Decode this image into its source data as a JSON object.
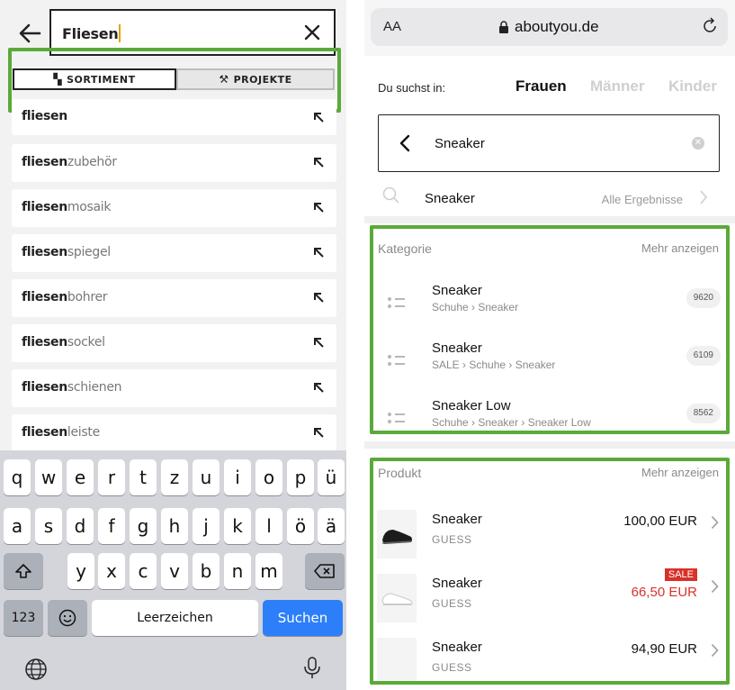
{
  "left": {
    "search": {
      "value": "Fliesen"
    },
    "tabs": [
      {
        "label": "SORTIMENT",
        "icon": "sortiment-icon"
      },
      {
        "label": "PROJEKTE",
        "icon": "worker-icon"
      }
    ],
    "suggestions": [
      {
        "bold": "fliesen",
        "rest": ""
      },
      {
        "bold": "fliesen",
        "rest": "zubehör"
      },
      {
        "bold": "fliesen",
        "rest": "mosaik"
      },
      {
        "bold": "fliesen",
        "rest": "spiegel"
      },
      {
        "bold": "fliesen",
        "rest": "bohrer"
      },
      {
        "bold": "fliesen",
        "rest": "sockel"
      },
      {
        "bold": "fliesen",
        "rest": "schienen"
      },
      {
        "bold": "fliesen",
        "rest": "leiste"
      }
    ],
    "keyboard": {
      "row1": [
        "q",
        "w",
        "e",
        "r",
        "t",
        "z",
        "u",
        "i",
        "o",
        "p",
        "ü"
      ],
      "row2": [
        "a",
        "s",
        "d",
        "f",
        "g",
        "h",
        "j",
        "k",
        "l",
        "ö",
        "ä"
      ],
      "row3": [
        "y",
        "x",
        "c",
        "v",
        "b",
        "n",
        "m"
      ],
      "numbers_key": "123",
      "space_key": "Leerzeichen",
      "search_key": "Suchen"
    }
  },
  "right": {
    "address_bar": {
      "text_size_label": "AA",
      "url": "aboutyou.de"
    },
    "gender": {
      "label": "Du suchst in:",
      "options": [
        "Frauen",
        "Männer",
        "Kinder"
      ],
      "selected": "Frauen"
    },
    "search": {
      "value": "Sneaker"
    },
    "suggestion": {
      "text": "Sneaker",
      "all_results": "Alle Ergebnisse"
    },
    "category_section": {
      "title": "Kategorie",
      "more": "Mehr anzeigen",
      "items": [
        {
          "name": "Sneaker",
          "path": "Schuhe › Sneaker",
          "count": "9620"
        },
        {
          "name": "Sneaker",
          "path": "SALE › Schuhe › Sneaker",
          "count": "6109"
        },
        {
          "name": "Sneaker Low",
          "path": "Schuhe › Sneaker › Sneaker Low",
          "count": "8562"
        }
      ]
    },
    "product_section": {
      "title": "Produkt",
      "more": "Mehr anzeigen",
      "items": [
        {
          "name": "Sneaker",
          "brand": "GUESS",
          "price": "100,00 EUR",
          "sale": ""
        },
        {
          "name": "Sneaker",
          "brand": "GUESS",
          "price": "66,50 EUR",
          "sale": "SALE"
        },
        {
          "name": "Sneaker",
          "brand": "GUESS",
          "price": "94,90 EUR",
          "sale": ""
        }
      ]
    }
  },
  "colors": {
    "highlight": "#5aaa3a",
    "sale": "#d8312a",
    "search_key": "#2d7ff9"
  }
}
